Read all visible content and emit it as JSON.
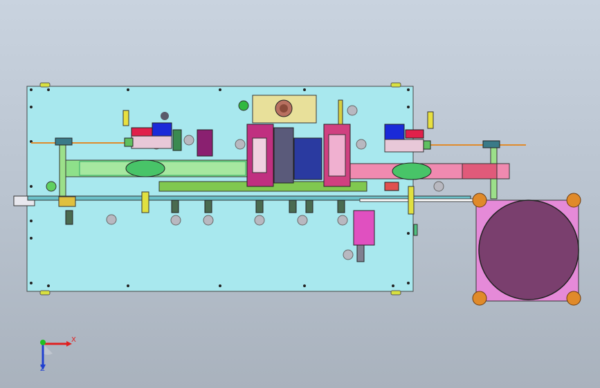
{
  "viewport": {
    "background_top": "#c9d3df",
    "background_bottom": "#a9b2bd"
  },
  "triad": {
    "x_label": "X",
    "z_label": "Z",
    "x_color": "#e02020",
    "y_color": "#20c020",
    "z_color": "#2040d0"
  },
  "colors": {
    "base_plate": "#a8e8ee",
    "belt": "#8ee08a",
    "belt_right": "#f08ab0",
    "turntable": "#7a3f6e",
    "turntable_frame": "#e58ad8",
    "foot": "#e08a2a",
    "motor": "#e8e09a",
    "blue_block": "#1a2ad8",
    "red_block": "#e0204a"
  }
}
